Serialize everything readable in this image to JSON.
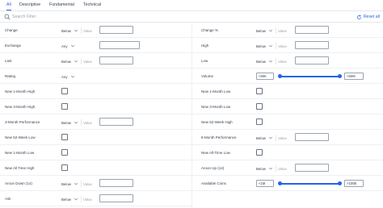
{
  "tabs": [
    {
      "label": "All",
      "active": true
    },
    {
      "label": "Descriptive",
      "active": false
    },
    {
      "label": "Fundamental",
      "active": false
    },
    {
      "label": "Technical",
      "active": false
    }
  ],
  "search": {
    "placeholder": "Search Filter"
  },
  "reset": {
    "label": "Reset all"
  },
  "colors": {
    "accent": "#2563eb",
    "text": "#374151",
    "muted": "#9ca3af"
  },
  "left": [
    {
      "label": "Change",
      "kind": "cmp",
      "select": "Below",
      "placeholder": "Value"
    },
    {
      "label": "Exchange",
      "kind": "select_box",
      "select": "Any"
    },
    {
      "label": "Last",
      "kind": "cmp",
      "select": "Below",
      "placeholder": "Value"
    },
    {
      "label": "Rating",
      "kind": "select_only",
      "select": "Any"
    },
    {
      "label": "New 1-Month High",
      "kind": "check"
    },
    {
      "label": "New 3-Month High",
      "kind": "check"
    },
    {
      "label": "3-Month Performance",
      "kind": "cmp",
      "select": "Below",
      "placeholder": "Value"
    },
    {
      "label": "New 52-Week Low",
      "kind": "check"
    },
    {
      "label": "New 1-Month Low",
      "kind": "check"
    },
    {
      "label": "New All Time High",
      "kind": "check"
    },
    {
      "label": "Aroon Down (14)",
      "kind": "cmp",
      "select": "Below",
      "placeholder": "Value"
    },
    {
      "label": "Ask",
      "kind": "cmp",
      "select": "Below",
      "placeholder": "Value"
    }
  ],
  "right": [
    {
      "label": "Change %",
      "kind": "cmp",
      "select": "Below",
      "placeholder": "Value"
    },
    {
      "label": "High",
      "kind": "cmp",
      "select": "Below",
      "placeholder": "Value"
    },
    {
      "label": "Low",
      "kind": "cmp",
      "select": "Below",
      "placeholder": "Value"
    },
    {
      "label": "Volume",
      "kind": "range",
      "min_label": "<50K",
      "max_label": ">50M"
    },
    {
      "label": "New 1-Month Low",
      "kind": "check"
    },
    {
      "label": "New 3-Month Low",
      "kind": "check"
    },
    {
      "label": "New 52-Week High",
      "kind": "check"
    },
    {
      "label": "6-Month Performance",
      "kind": "cmp",
      "select": "Below",
      "placeholder": "Value"
    },
    {
      "label": "New All-Time Low",
      "kind": "check"
    },
    {
      "label": "Aroon Up (14)",
      "kind": "cmp",
      "select": "Below",
      "placeholder": "Value"
    },
    {
      "label": "Available Coins",
      "kind": "range",
      "min_label": "<1M",
      "max_label": ">100B"
    }
  ]
}
